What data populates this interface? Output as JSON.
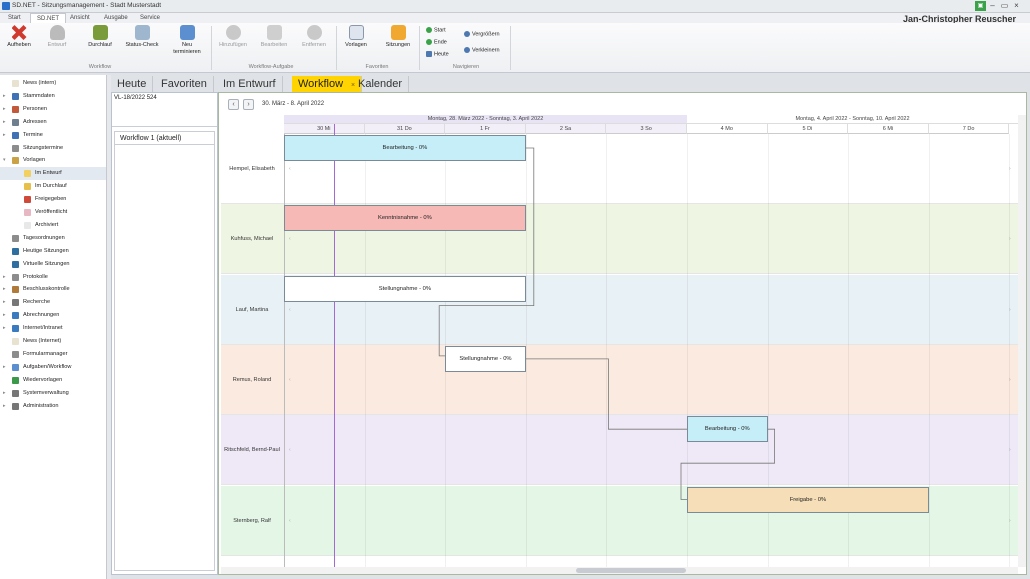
{
  "window": {
    "title": "SD.NET - Sitzungsmanagement - Stadt Musterstadt",
    "user": "Jan-Christopher Reuscher"
  },
  "ribbon_tabs": [
    "Start",
    "SD.NET",
    "Ansicht",
    "Ausgabe",
    "Service"
  ],
  "ribbon": {
    "workflow": {
      "label": "Workflow",
      "buttons": [
        "Aufheben",
        "Entwurf",
        "Durchlauf",
        "Status-Check",
        "Neu terminieren"
      ]
    },
    "aufgabe": {
      "label": "Workflow-Aufgabe",
      "buttons": [
        "Hinzufügen",
        "Bearbeiten",
        "Entfernen"
      ]
    },
    "favoriten": {
      "label": "Favoriten",
      "buttons": [
        "Vorlagen",
        "Sitzungen"
      ]
    },
    "navigieren": {
      "label": "Navigieren",
      "items": [
        "Start",
        "Ende",
        "Heute",
        "Vergrößern",
        "Verkleinern"
      ]
    }
  },
  "sidebar": {
    "items": [
      {
        "label": "News (intern)",
        "exp": "",
        "indent": 0
      },
      {
        "label": "Stammdaten",
        "exp": "▸",
        "indent": 0
      },
      {
        "label": "Personen",
        "exp": "▸",
        "indent": 0
      },
      {
        "label": "Adressen",
        "exp": "▸",
        "indent": 0
      },
      {
        "label": "Termine",
        "exp": "▸",
        "indent": 0
      },
      {
        "label": "Sitzungstermine",
        "exp": "",
        "indent": 0
      },
      {
        "label": "Vorlagen",
        "exp": "▾",
        "indent": 0
      },
      {
        "label": "Im Entwurf",
        "exp": "",
        "indent": 1
      },
      {
        "label": "Im Durchlauf",
        "exp": "",
        "indent": 1
      },
      {
        "label": "Freigegeben",
        "exp": "",
        "indent": 1
      },
      {
        "label": "Veröffentlicht",
        "exp": "",
        "indent": 1
      },
      {
        "label": "Archiviert",
        "exp": "",
        "indent": 1
      },
      {
        "label": "Tagesordnungen",
        "exp": "",
        "indent": 0
      },
      {
        "label": "Heutige Sitzungen",
        "exp": "",
        "indent": 0
      },
      {
        "label": "Virtuelle Sitzungen",
        "exp": "",
        "indent": 0
      },
      {
        "label": "Protokolle",
        "exp": "▸",
        "indent": 0
      },
      {
        "label": "Beschlusskontrolle",
        "exp": "▸",
        "indent": 0
      },
      {
        "label": "Recherche",
        "exp": "▸",
        "indent": 0
      },
      {
        "label": "Abrechnungen",
        "exp": "▸",
        "indent": 0
      },
      {
        "label": "Internet/Intranet",
        "exp": "▸",
        "indent": 0
      },
      {
        "label": "News (Internet)",
        "exp": "",
        "indent": 0
      },
      {
        "label": "Formularmanager",
        "exp": "",
        "indent": 0
      },
      {
        "label": "Aufgaben/Workflow",
        "exp": "▸",
        "indent": 0
      },
      {
        "label": "Wiedervorlagen",
        "exp": "",
        "indent": 0
      },
      {
        "label": "Systemverwaltung",
        "exp": "▸",
        "indent": 0
      },
      {
        "label": "Administration",
        "exp": "▸",
        "indent": 0
      }
    ]
  },
  "main_tabs": [
    "Heute",
    "Favoriten",
    "Im Entwurf",
    "Workflow",
    "Kalender"
  ],
  "vorlage": "VL-18/2022 524",
  "workflow_name": "Workflow 1 (aktuell)",
  "range": "30. März - 8. April 2022",
  "weeks": [
    "Montag, 28. März 2022 - Sonntag, 3. April 2022",
    "Montag, 4. April 2022 - Sonntag, 10. April 2022"
  ],
  "days": [
    "30 Mi",
    "31 Do",
    "1 Fr",
    "2 Sa",
    "3 So",
    "4 Mo",
    "5 Di",
    "6 Mi",
    "7 Do"
  ],
  "lanes": [
    {
      "name": "Hempel, Elisabeth",
      "color": "#ffffff"
    },
    {
      "name": "Kuhfuss, Michael",
      "color": "#eef5e2"
    },
    {
      "name": "Lauf, Martina",
      "color": "#e8f1f6"
    },
    {
      "name": "Remus, Roland",
      "color": "#fbeadf"
    },
    {
      "name": "Ritschfeld, Bernd-Paul",
      "color": "#efe9f7"
    },
    {
      "name": "Sternberg, Ralf",
      "color": "#e4f6e6"
    }
  ],
  "tasks": [
    {
      "label": "Bearbeitung - 0%",
      "color": "#c6eef8"
    },
    {
      "label": "Kenntnisnahme - 0%",
      "color": "#f7b9b6"
    },
    {
      "label": "Stellungnahme - 0%",
      "color": "#ffffff"
    },
    {
      "label": "Stellungnahme - 0%",
      "color": "#ffffff"
    },
    {
      "label": "Bearbeitung - 0%",
      "color": "#c6eef8"
    },
    {
      "label": "Freigabe - 0%",
      "color": "#f6dfb8"
    }
  ]
}
